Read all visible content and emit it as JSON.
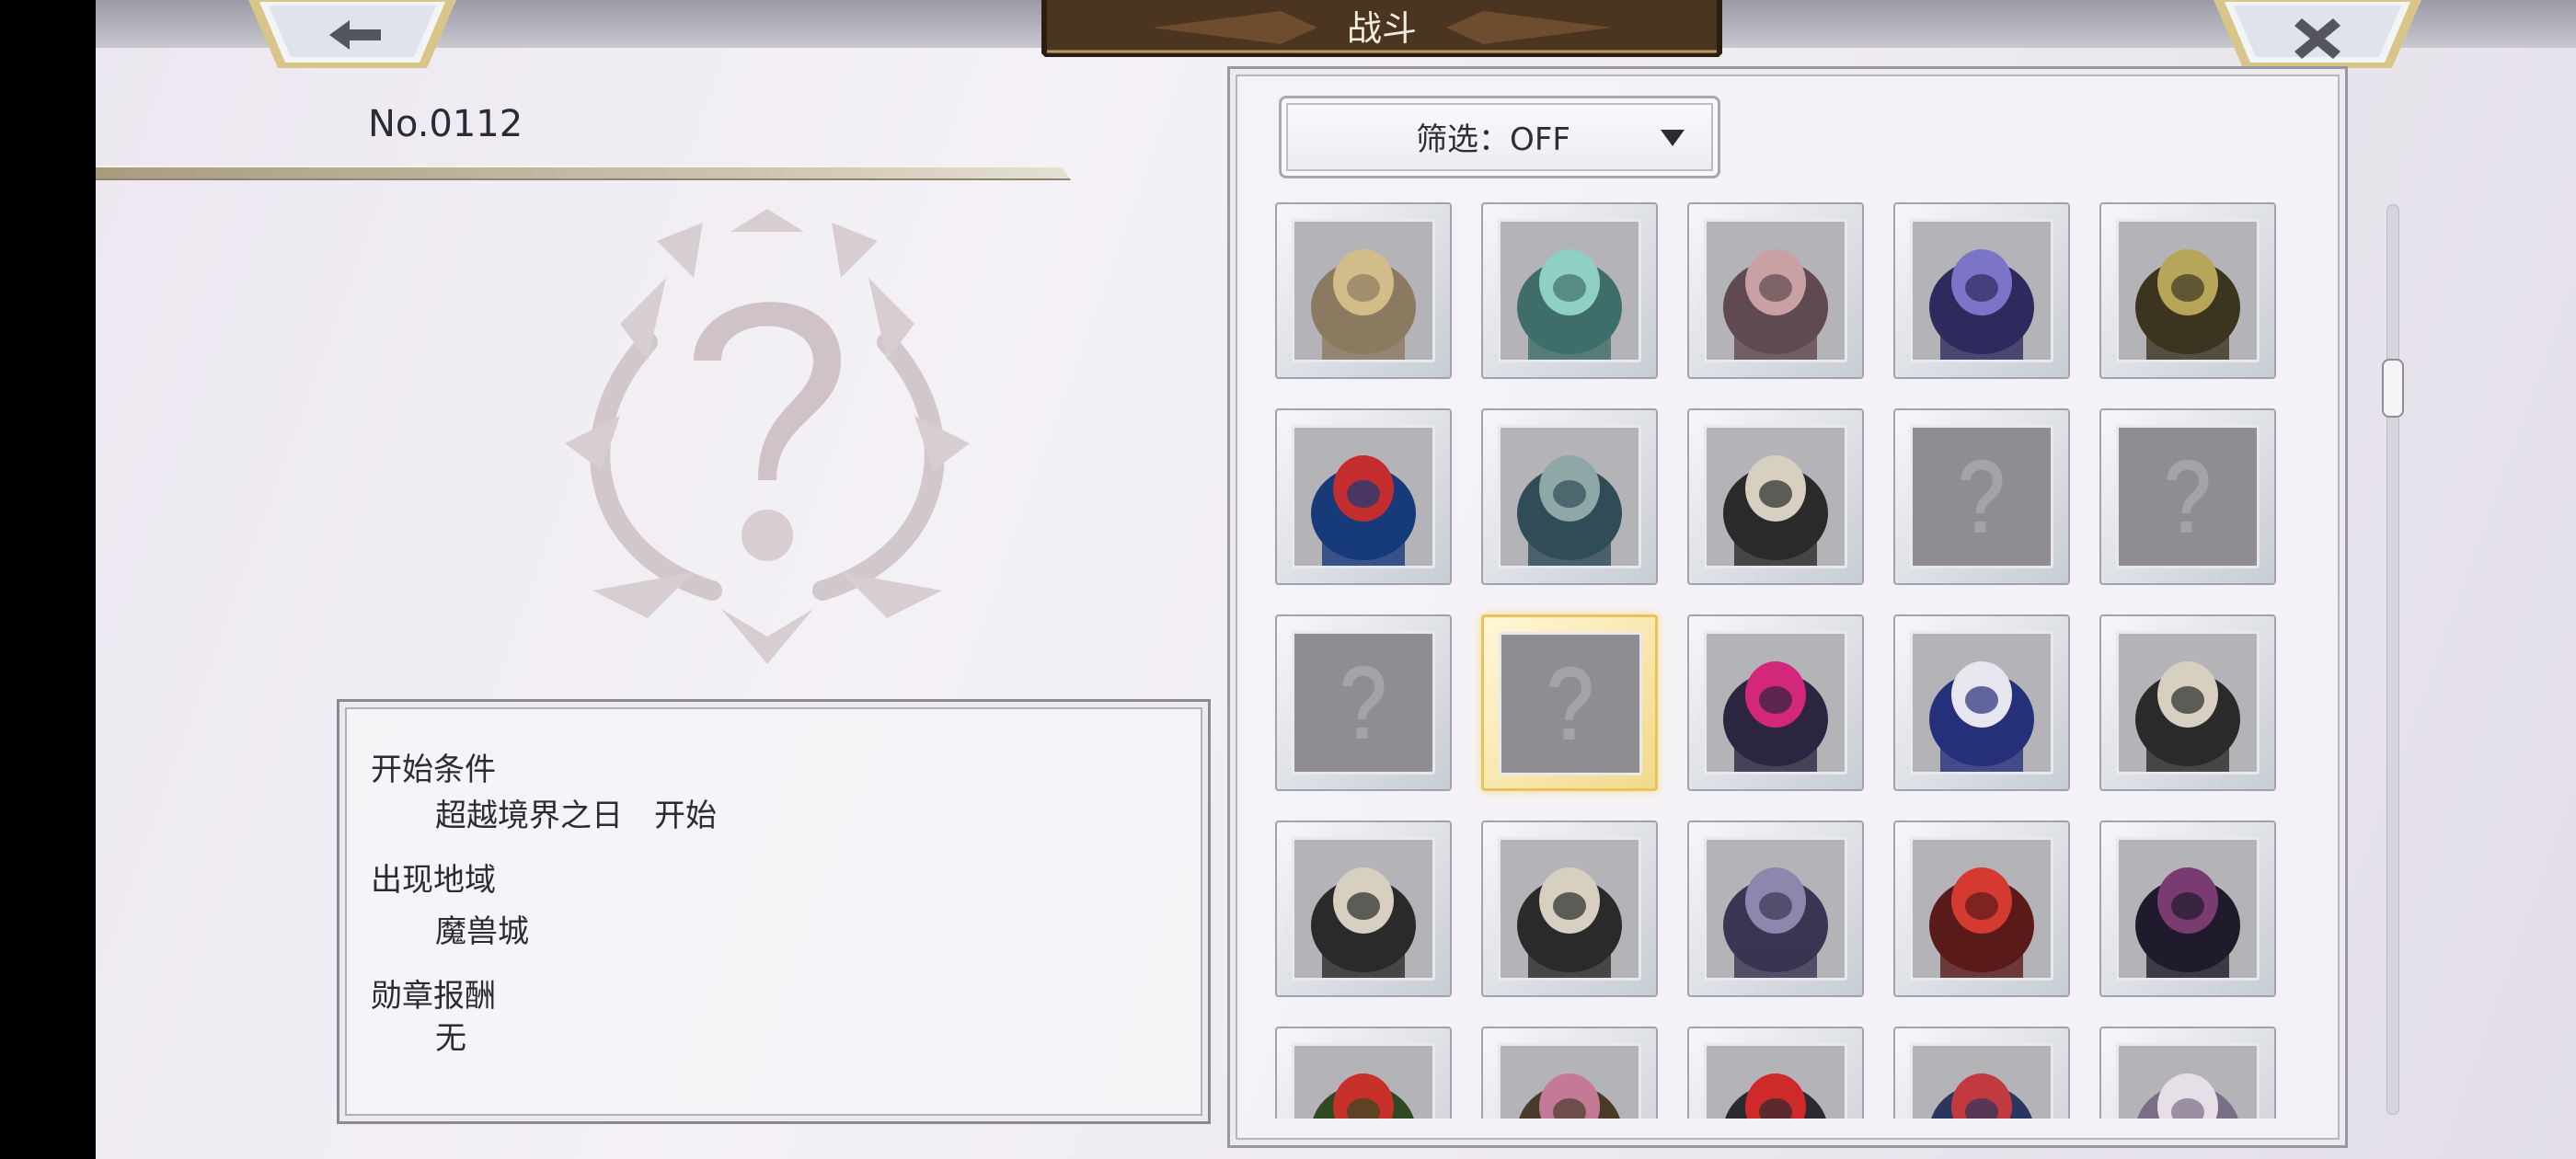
{
  "header": {
    "title": "战斗",
    "back_icon": "arrow-left-icon",
    "close_icon": "close-icon"
  },
  "detail": {
    "number": "No.0112",
    "emblem_icon": "unknown-question-emblem-icon",
    "sections": [
      {
        "heading": "开始条件",
        "value": "超越境界之日　开始"
      },
      {
        "heading": "出现地域",
        "value": "魔兽城"
      },
      {
        "heading": "勋章报酬",
        "value": "无"
      }
    ]
  },
  "filter": {
    "label": "筛选：OFF",
    "arrow_icon": "dropdown-triangle-icon"
  },
  "grid": {
    "selected_index": 11,
    "items": [
      {
        "icon": "gold-horned-knight-icon",
        "known": true,
        "palette": [
          "#8a7a60",
          "#d2bd8a"
        ]
      },
      {
        "icon": "teal-crystal-shard-icon",
        "known": true,
        "palette": [
          "#3f6e6a",
          "#8fd0c4"
        ]
      },
      {
        "icon": "ring-staff-icon",
        "known": true,
        "palette": [
          "#5e4a50",
          "#c9a0a4"
        ]
      },
      {
        "icon": "purple-orb-creature-icon",
        "known": true,
        "palette": [
          "#2e2a5e",
          "#7b75c8"
        ]
      },
      {
        "icon": "olive-eye-mask-icon",
        "known": true,
        "palette": [
          "#3b3520",
          "#b7a55a"
        ]
      },
      {
        "icon": "blue-horned-dragon-icon",
        "known": true,
        "palette": [
          "#173a7a",
          "#c42d2d"
        ]
      },
      {
        "icon": "gorgon-warrior-icon",
        "known": true,
        "palette": [
          "#2f4c57",
          "#8fa7a6"
        ]
      },
      {
        "icon": "helmed-fur-warrior-icon",
        "known": true,
        "palette": [
          "#2a2a2a",
          "#d7cfbf"
        ]
      },
      {
        "icon": "unknown-monster-icon",
        "known": false,
        "palette": [
          "#8f8d92",
          "#a6a3a8"
        ]
      },
      {
        "icon": "unknown-monster-icon",
        "known": false,
        "palette": [
          "#8f8d92",
          "#a6a3a8"
        ]
      },
      {
        "icon": "unknown-monster-icon",
        "known": false,
        "palette": [
          "#8f8d92",
          "#a6a3a8"
        ]
      },
      {
        "icon": "unknown-monster-icon",
        "known": false,
        "palette": [
          "#8f8d92",
          "#a6a3a8"
        ]
      },
      {
        "icon": "magenta-eye-bat-icon",
        "known": true,
        "palette": [
          "#2b2540",
          "#d2277a"
        ]
      },
      {
        "icon": "hooded-blue-ninja-icon",
        "known": true,
        "palette": [
          "#26307a",
          "#e7e5ee"
        ]
      },
      {
        "icon": "helmed-fur-warrior-icon",
        "known": true,
        "palette": [
          "#2a2a2a",
          "#d7cfbf"
        ]
      },
      {
        "icon": "helmed-fur-warrior-icon",
        "known": true,
        "palette": [
          "#2a2a2a",
          "#d7cfbf"
        ]
      },
      {
        "icon": "helmed-fur-warrior-icon",
        "known": true,
        "palette": [
          "#2a2a2a",
          "#d7cfbf"
        ]
      },
      {
        "icon": "violet-dragon-icon",
        "known": true,
        "palette": [
          "#3b3452",
          "#8e86ad"
        ]
      },
      {
        "icon": "red-armored-warrior-icon",
        "known": true,
        "palette": [
          "#5a1a1a",
          "#d43a30"
        ]
      },
      {
        "icon": "dark-winged-demon-icon",
        "known": true,
        "palette": [
          "#1f1b2c",
          "#7a3c70"
        ]
      },
      {
        "icon": "green-orc-icon",
        "known": true,
        "palette": [
          "#2f4a22",
          "#c8302a"
        ]
      },
      {
        "icon": "horned-beast-icon",
        "known": true,
        "palette": [
          "#4a3a2a",
          "#c47a96"
        ]
      },
      {
        "icon": "red-horned-demon-icon",
        "known": true,
        "palette": [
          "#2a2a30",
          "#cf2a2a"
        ]
      },
      {
        "icon": "red-haired-knight-icon",
        "known": true,
        "palette": [
          "#2a3560",
          "#c23a40"
        ]
      },
      {
        "icon": "pearl-serpent-icon",
        "known": true,
        "palette": [
          "#7a6e86",
          "#e6dfe8"
        ]
      }
    ]
  }
}
